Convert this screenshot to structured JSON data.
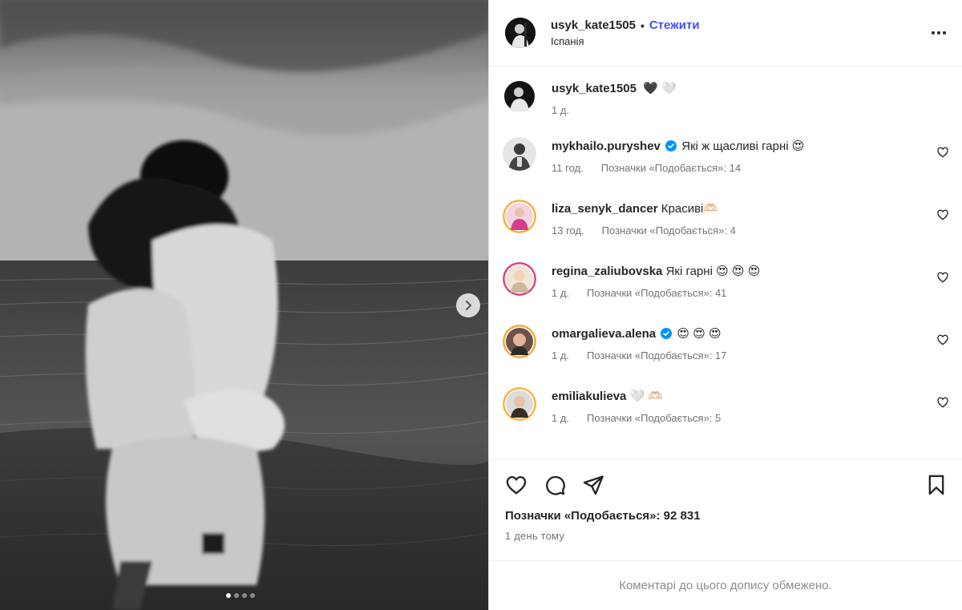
{
  "post": {
    "username": "usyk_kate1505",
    "follow_label": "Стежити",
    "location": "Іспанія",
    "caption_emojis": "🖤 🤍",
    "caption_time": "1 д."
  },
  "comments": [
    {
      "username": "mykhailo.puryshev",
      "verified": true,
      "text": "Які ж щасливі гарні 😍",
      "time": "11 год.",
      "likes": "Позначки «Подобається»: 14"
    },
    {
      "username": "liza_senyk_dancer",
      "verified": false,
      "text": "Красиві🫶🏻",
      "time": "13 год.",
      "likes": "Позначки «Подобається»: 4"
    },
    {
      "username": "regina_zaliubovska",
      "verified": false,
      "text": "Які гарні 😍 😍 😍",
      "time": "1 д.",
      "likes": "Позначки «Подобається»: 41"
    },
    {
      "username": "omargalieva.alena",
      "verified": true,
      "text": "😍 😍 😍",
      "time": "1 д.",
      "likes": "Позначки «Подобається»: 17"
    },
    {
      "username": "emiliakulieva",
      "verified": false,
      "text": "🤍 🫶🏻",
      "time": "1 д.",
      "likes": "Позначки «Подобається»: 5"
    }
  ],
  "stats": {
    "likes_total": "Позначки «Подобається»: 92 831",
    "posted": "1 день тому"
  },
  "footer": {
    "comments_limited": "Коментарі до цього допису обмежено."
  },
  "carousel": {
    "slide_index": 1,
    "slide_count": 4
  },
  "colors": {
    "follow": "#4150f7",
    "verified": "#0095f6",
    "muted": "#737373"
  }
}
